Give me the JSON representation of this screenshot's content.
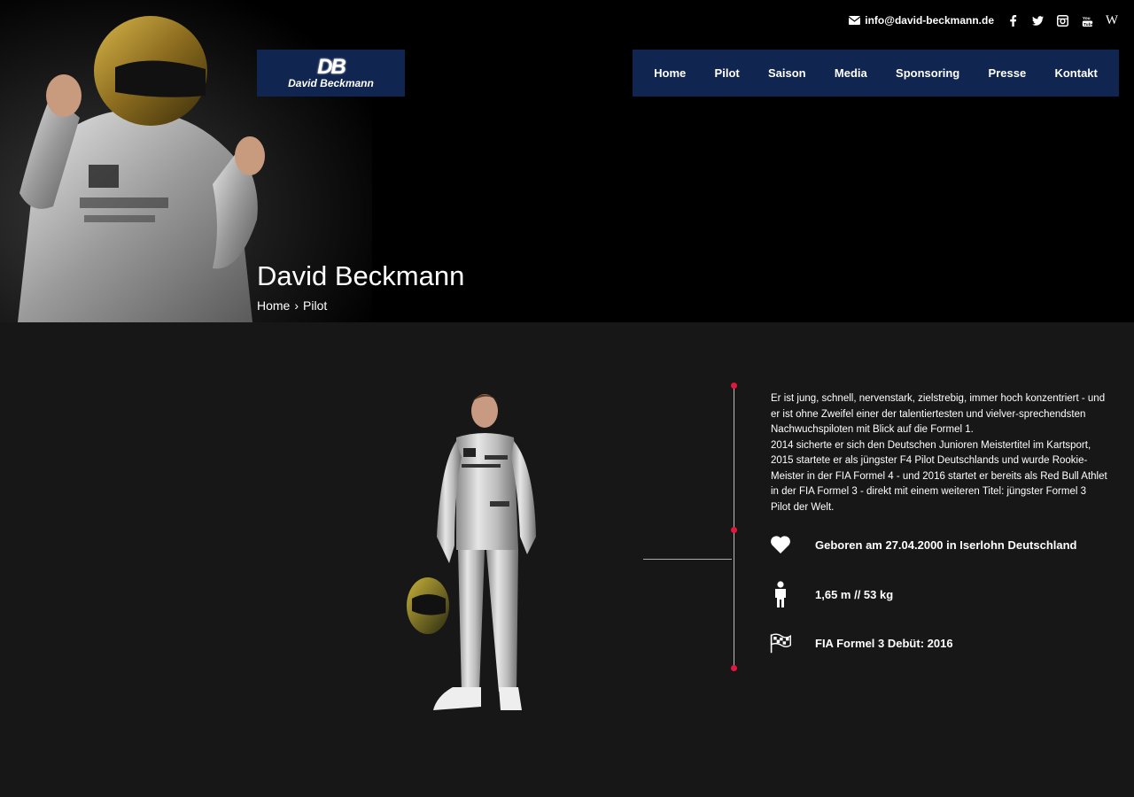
{
  "header": {
    "email": "info@david-beckmann.de",
    "social": [
      "facebook-icon",
      "twitter-icon",
      "instagram-icon",
      "youtube-icon",
      "wikipedia-icon"
    ],
    "wiki_glyph": "W"
  },
  "logo": {
    "mark": "DB",
    "name": "David Beckmann"
  },
  "nav": {
    "items": [
      "Home",
      "Pilot",
      "Saison",
      "Media",
      "Sponsoring",
      "Presse",
      "Kontakt"
    ]
  },
  "hero": {
    "title": "David Beckmann",
    "breadcrumb": {
      "home": "Home",
      "separator": "›",
      "current": "Pilot"
    }
  },
  "content": {
    "bio": [
      "Er ist jung, schnell, nervenstark, zielstrebig, immer hoch konzentriert - und er ist ohne Zweifel einer der talentiertesten und vielver-sprechendsten Nachwuchspiloten mit Blick auf die Formel 1.",
      "2014 sicherte er sich den Deutschen Junioren Meistertitel im Kartsport, 2015 startete er als jüngster F4 Pilot Deutschlands und wurde Rookie-Meister in der FIA Formel 4 - und 2016 startet er bereits als Red Bull Athlet in der FIA Formel 3 - direkt mit einem weiteren Titel: jüngster Formel 3 Pilot der Welt."
    ],
    "facts": [
      {
        "icon": "heart-icon",
        "text": "Geboren am 27.04.2000 in Iserlohn Deutschland"
      },
      {
        "icon": "person-icon",
        "text": "1,65 m // 53 kg"
      },
      {
        "icon": "checkered-flag-icon",
        "text": "FIA Formel 3 Debüt: 2016"
      }
    ]
  },
  "colors": {
    "nav_bg": "#10254f",
    "accent_dot": "#e5163d",
    "content_bg": "#171717",
    "hero_bg": "#000000"
  }
}
